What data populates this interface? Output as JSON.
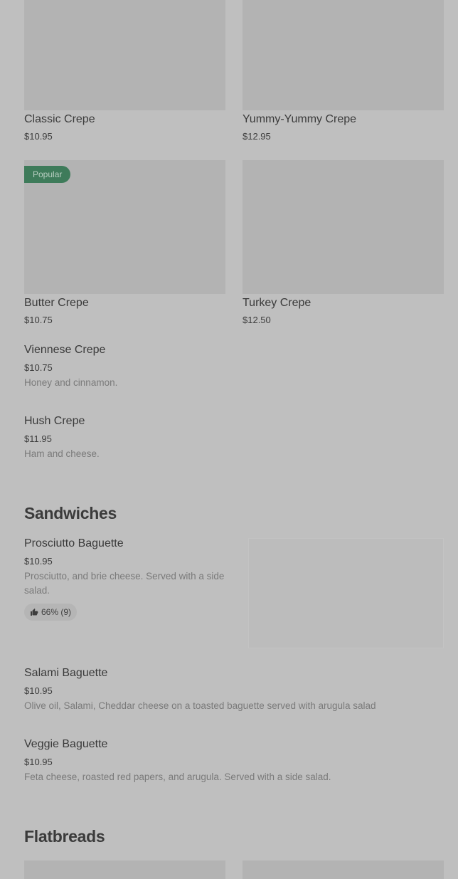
{
  "grid1": [
    {
      "name": "Classic Crepe",
      "price": "$10.95"
    },
    {
      "name": "Yummy-Yummy Crepe",
      "price": "$12.95"
    },
    {
      "name": "Butter Crepe",
      "price": "$10.75",
      "badge": "Popular"
    },
    {
      "name": "Turkey Crepe",
      "price": "$12.50"
    }
  ],
  "list_items": [
    {
      "name": "Viennese Crepe",
      "price": "$10.75",
      "desc": "Honey and cinnamon."
    },
    {
      "name": "Hush Crepe",
      "price": "$11.95",
      "desc": "Ham and cheese."
    }
  ],
  "sandwiches": {
    "title": "Sandwiches",
    "items": [
      {
        "name": "Prosciutto Baguette",
        "price": "$10.95",
        "desc": "Prosciutto, and brie cheese. Served with a side salad.",
        "rating": "66% (9)",
        "rating_icon": "thumbs-up-icon"
      },
      {
        "name": "Salami Baguette",
        "price": "$10.95",
        "desc": "Olive oil, Salami, Cheddar cheese on a toasted baguette served with arugula salad"
      },
      {
        "name": "Veggie Baguette",
        "price": "$10.95",
        "desc": "Feta cheese, roasted red papers, and arugula. Served with a side salad."
      }
    ]
  },
  "flatbreads": {
    "title": "Flatbreads"
  },
  "colors": {
    "background": "#bfbfbf",
    "badge": "#3e7b5a",
    "image_placeholder": "#b3b3b3"
  }
}
